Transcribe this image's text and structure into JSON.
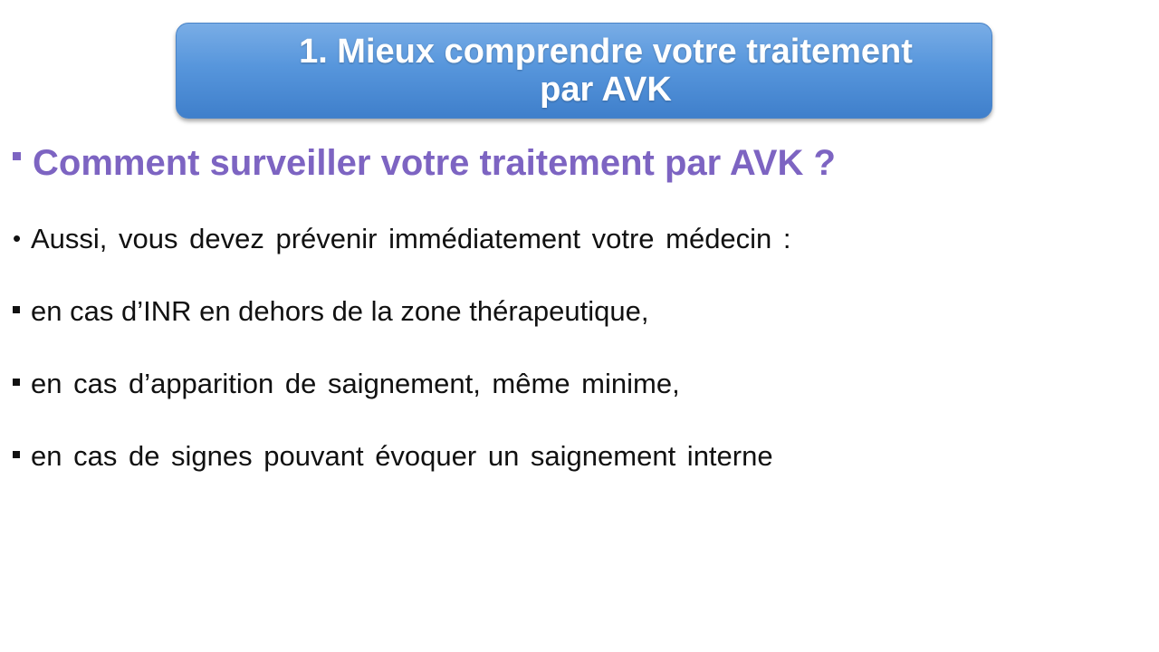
{
  "slide": {
    "title_line1": "1. Mieux comprendre votre traitement",
    "title_line2": "par AVK",
    "heading": "Comment surveiller votre traitement par AVK ?",
    "intro": "Aussi, vous devez prévenir immédiatement votre médecin :",
    "items": [
      "en cas d’INR en dehors de la zone thérapeutique,",
      "en cas d’apparition de saignement, même minime,",
      "en cas de signes pouvant évoquer un saignement interne"
    ]
  },
  "colors": {
    "title_gradient_top": "#79ade6",
    "title_gradient_bottom": "#3f7fcb",
    "heading": "#7d64c2",
    "body_text": "#111111"
  }
}
